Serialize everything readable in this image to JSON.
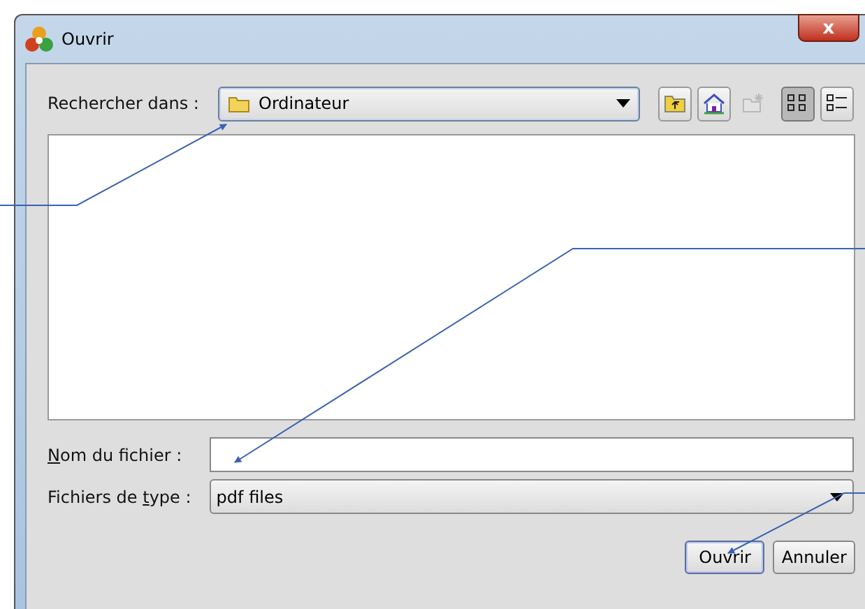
{
  "window": {
    "title": "Ouvrir",
    "close": "x"
  },
  "look_in": {
    "label": "Rechercher dans :",
    "value": "Ordinateur"
  },
  "toolbar": [
    {
      "kind": "up",
      "disabled": false,
      "selected": false
    },
    {
      "kind": "home",
      "disabled": false,
      "selected": false
    },
    {
      "kind": "new-folder",
      "disabled": true,
      "selected": false
    },
    {
      "kind": "list",
      "disabled": false,
      "selected": true
    },
    {
      "kind": "details",
      "disabled": false,
      "selected": false
    }
  ],
  "fields": [
    {
      "kind": "text",
      "label": [
        {
          "text": "N",
          "underlined": true
        },
        {
          "text": "om du fichier :",
          "underlined": false
        }
      ]
    },
    {
      "kind": "combo",
      "label": [
        {
          "text": "Fichiers de ",
          "underlined": false
        },
        {
          "text": "t",
          "underlined": true
        },
        {
          "text": "ype :",
          "underlined": false
        }
      ],
      "value": "pdf files"
    }
  ],
  "buttons": [
    {
      "label": "Ouvrir",
      "default": true
    },
    {
      "label": "Annuler",
      "default": false
    }
  ]
}
